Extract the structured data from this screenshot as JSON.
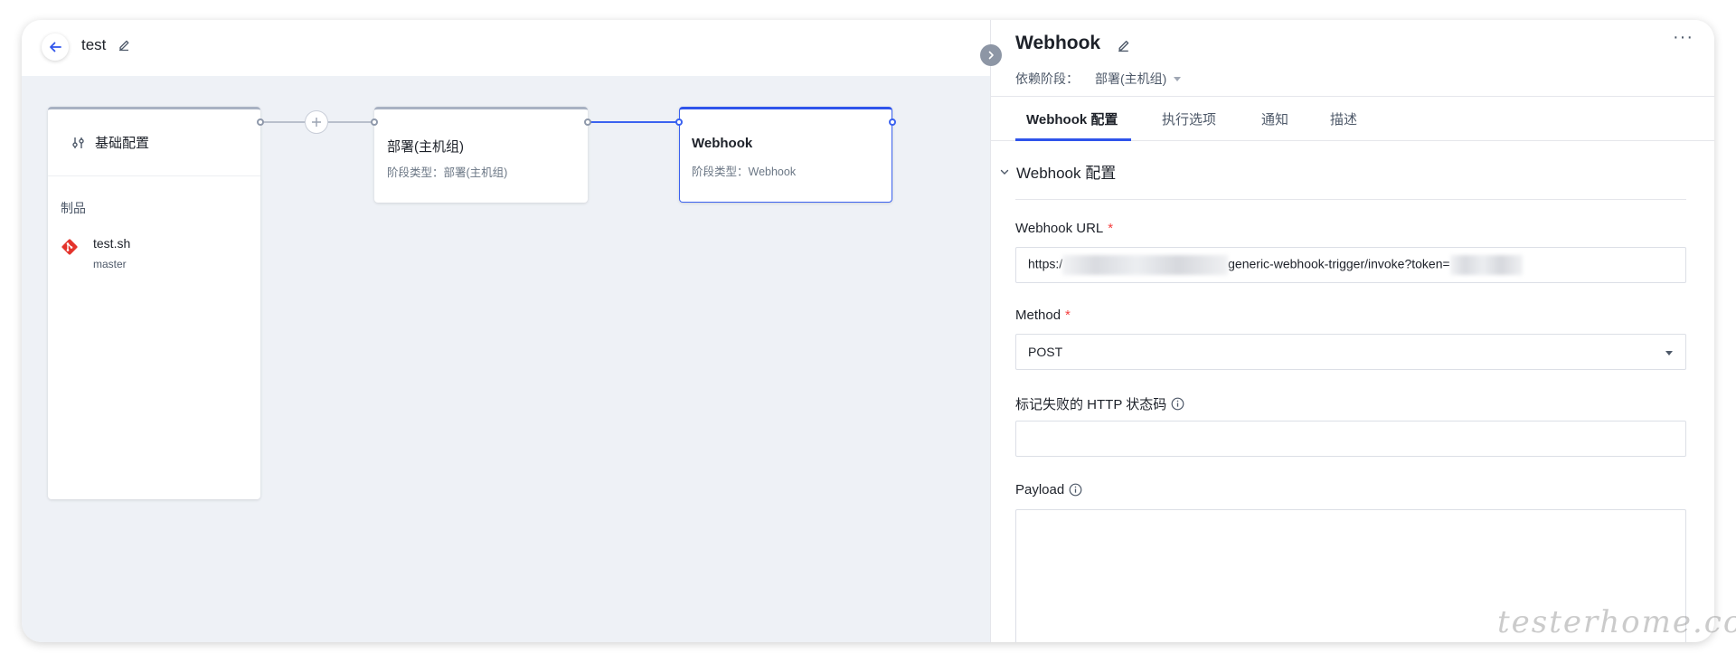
{
  "header": {
    "pipeline_name": "test"
  },
  "stages": {
    "base": {
      "title": "基础配置",
      "artifacts_label": "制品",
      "artifact": {
        "name": "test.sh",
        "branch": "master"
      }
    },
    "deploy": {
      "title": "部署(主机组)",
      "subtitle": "阶段类型：部署(主机组)"
    },
    "webhook": {
      "title": "Webhook",
      "subtitle": "阶段类型：Webhook"
    }
  },
  "panel": {
    "title": "Webhook",
    "dependency_label": "依赖阶段：",
    "dependency_value": "部署(主机组)",
    "tabs": [
      {
        "label": "Webhook 配置",
        "active": true
      },
      {
        "label": "执行选项",
        "active": false
      },
      {
        "label": "通知",
        "active": false
      },
      {
        "label": "描述",
        "active": false
      }
    ],
    "section_title": "Webhook 配置",
    "fields": {
      "url": {
        "label": "Webhook URL",
        "value_prefix": "https:/",
        "value_middle": "generic-webhook-trigger/invoke?token="
      },
      "method": {
        "label": "Method",
        "value": "POST"
      },
      "fail_codes": {
        "label": "标记失败的 HTTP 状态码",
        "value": ""
      },
      "payload": {
        "label": "Payload",
        "value": ""
      }
    },
    "required_mark": "*",
    "more_label": "···"
  },
  "watermark": "testerhome.com",
  "colors": {
    "accent": "#2f54eb",
    "required": "#f53f3f",
    "canvas_bg": "#eef1f6"
  }
}
